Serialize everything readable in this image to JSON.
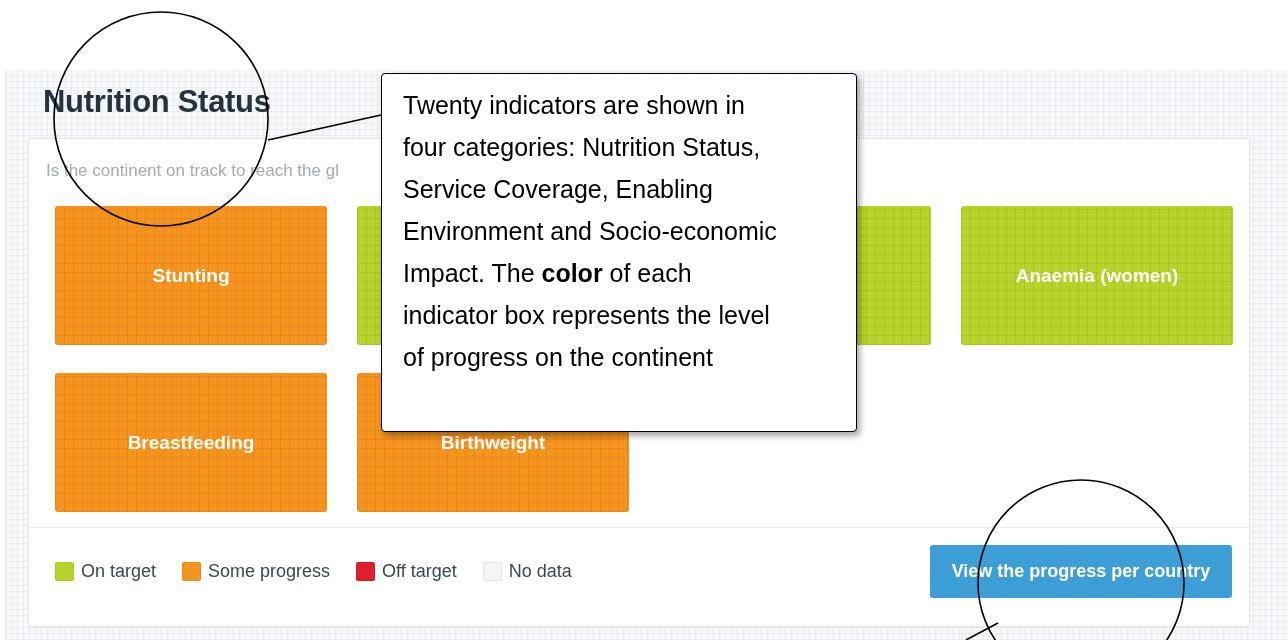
{
  "section": {
    "title": "Nutrition Status",
    "subtitle": "Is the continent on track to reach the gl"
  },
  "indicators": [
    {
      "label": "Stunting",
      "color": "#f7941d"
    },
    {
      "color": "#b7d42a"
    },
    {
      "color": "#b7d42a"
    },
    {
      "label": "Anaemia (women)",
      "color": "#b7d42a"
    },
    {
      "label": "Breastfeeding",
      "color": "#f7941d"
    },
    {
      "label": "Birthweight",
      "color": "#f7941d"
    }
  ],
  "legend": [
    {
      "label": "On target",
      "color": "#b7d42a"
    },
    {
      "label": "Some progress",
      "color": "#f7941d"
    },
    {
      "label": "Off target",
      "color": "#e01f2c"
    },
    {
      "label": "No data",
      "color": "#f4f5f7"
    }
  ],
  "button": "View the progress per country",
  "callout": {
    "text": "Twenty indicators are shown in four categories: Nutrition Status, Service Coverage, Enabling Environment and Socio-economic Impact. The **color** of each indicator box represents the level of progress on the continent"
  }
}
